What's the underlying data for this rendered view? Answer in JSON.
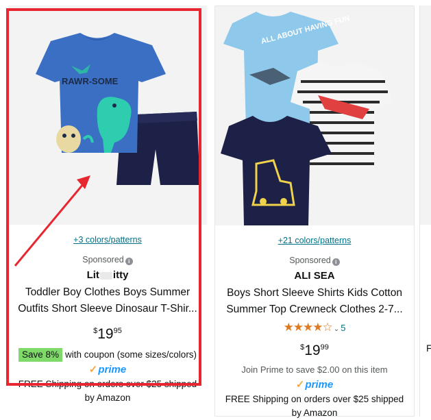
{
  "products": [
    {
      "colors_link": "+3 colors/patterns",
      "sponsored": "Sponsored",
      "brand_left": "Lit",
      "brand_right": "itty",
      "title_line1": "Toddler Boy Clothes Boys Summer",
      "title_line2": "Outfits Short Sleeve Dinosaur T-Shir...",
      "price": {
        "symbol": "$",
        "whole": "19",
        "fraction": "95"
      },
      "coupon_badge": "Save 8%",
      "coupon_text": "with coupon (some sizes/colors)",
      "prime_label": "prime",
      "shipping_line1": "FREE Shipping on orders over $25 shipped",
      "shipping_line2": "by Amazon",
      "image_text": "RAWR-SOME"
    },
    {
      "colors_link": "+21 colors/patterns",
      "sponsored": "Sponsored",
      "brand": "ALI SEA",
      "title_line1": "Boys Short Sleeve Shirts Kids Cotton",
      "title_line2": "Summer Top Crewneck Clothes 2-7...",
      "rating_stars": 4,
      "rating_count": "5",
      "price": {
        "symbol": "$",
        "whole": "19",
        "fraction": "99"
      },
      "join_prime": "Join Prime to save $2.00 on this item",
      "prime_label": "prime",
      "shipping_line1": "FREE Shipping on orders over $25 shipped",
      "shipping_line2": "by Amazon",
      "image_text": "ALL ABOUT HAVING FUN"
    }
  ],
  "annotation": {
    "highlight_color": "#e8262f"
  },
  "partial_third": "F"
}
